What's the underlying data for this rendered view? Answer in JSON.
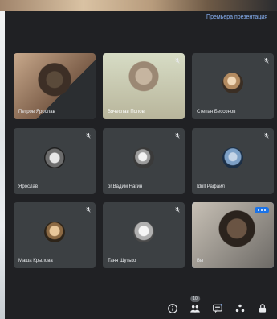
{
  "header": {
    "presenting_text": "Премьера презентация"
  },
  "participants": [
    {
      "name": "Петров Ярослав"
    },
    {
      "name": "Вячеслав Попов"
    },
    {
      "name": "Степан Бессонов"
    },
    {
      "name": "Ярослав"
    },
    {
      "name": "pr.Вадим Нагин"
    },
    {
      "name": "Idrill Рафаил"
    },
    {
      "name": "Маша Крылова"
    },
    {
      "name": "Таня Шутько"
    },
    {
      "name": "Вы"
    }
  ],
  "controls": {
    "people_count": "10",
    "info_icon": "info-icon",
    "people_icon": "people-icon",
    "chat_icon": "chat-icon",
    "activities_icon": "activities-icon",
    "lock_icon": "lock-icon"
  },
  "colors": {
    "accent": "#8ab4f8",
    "self_badge": "#1a73e8",
    "tile_bg": "#3c4043",
    "bg": "#202124"
  }
}
